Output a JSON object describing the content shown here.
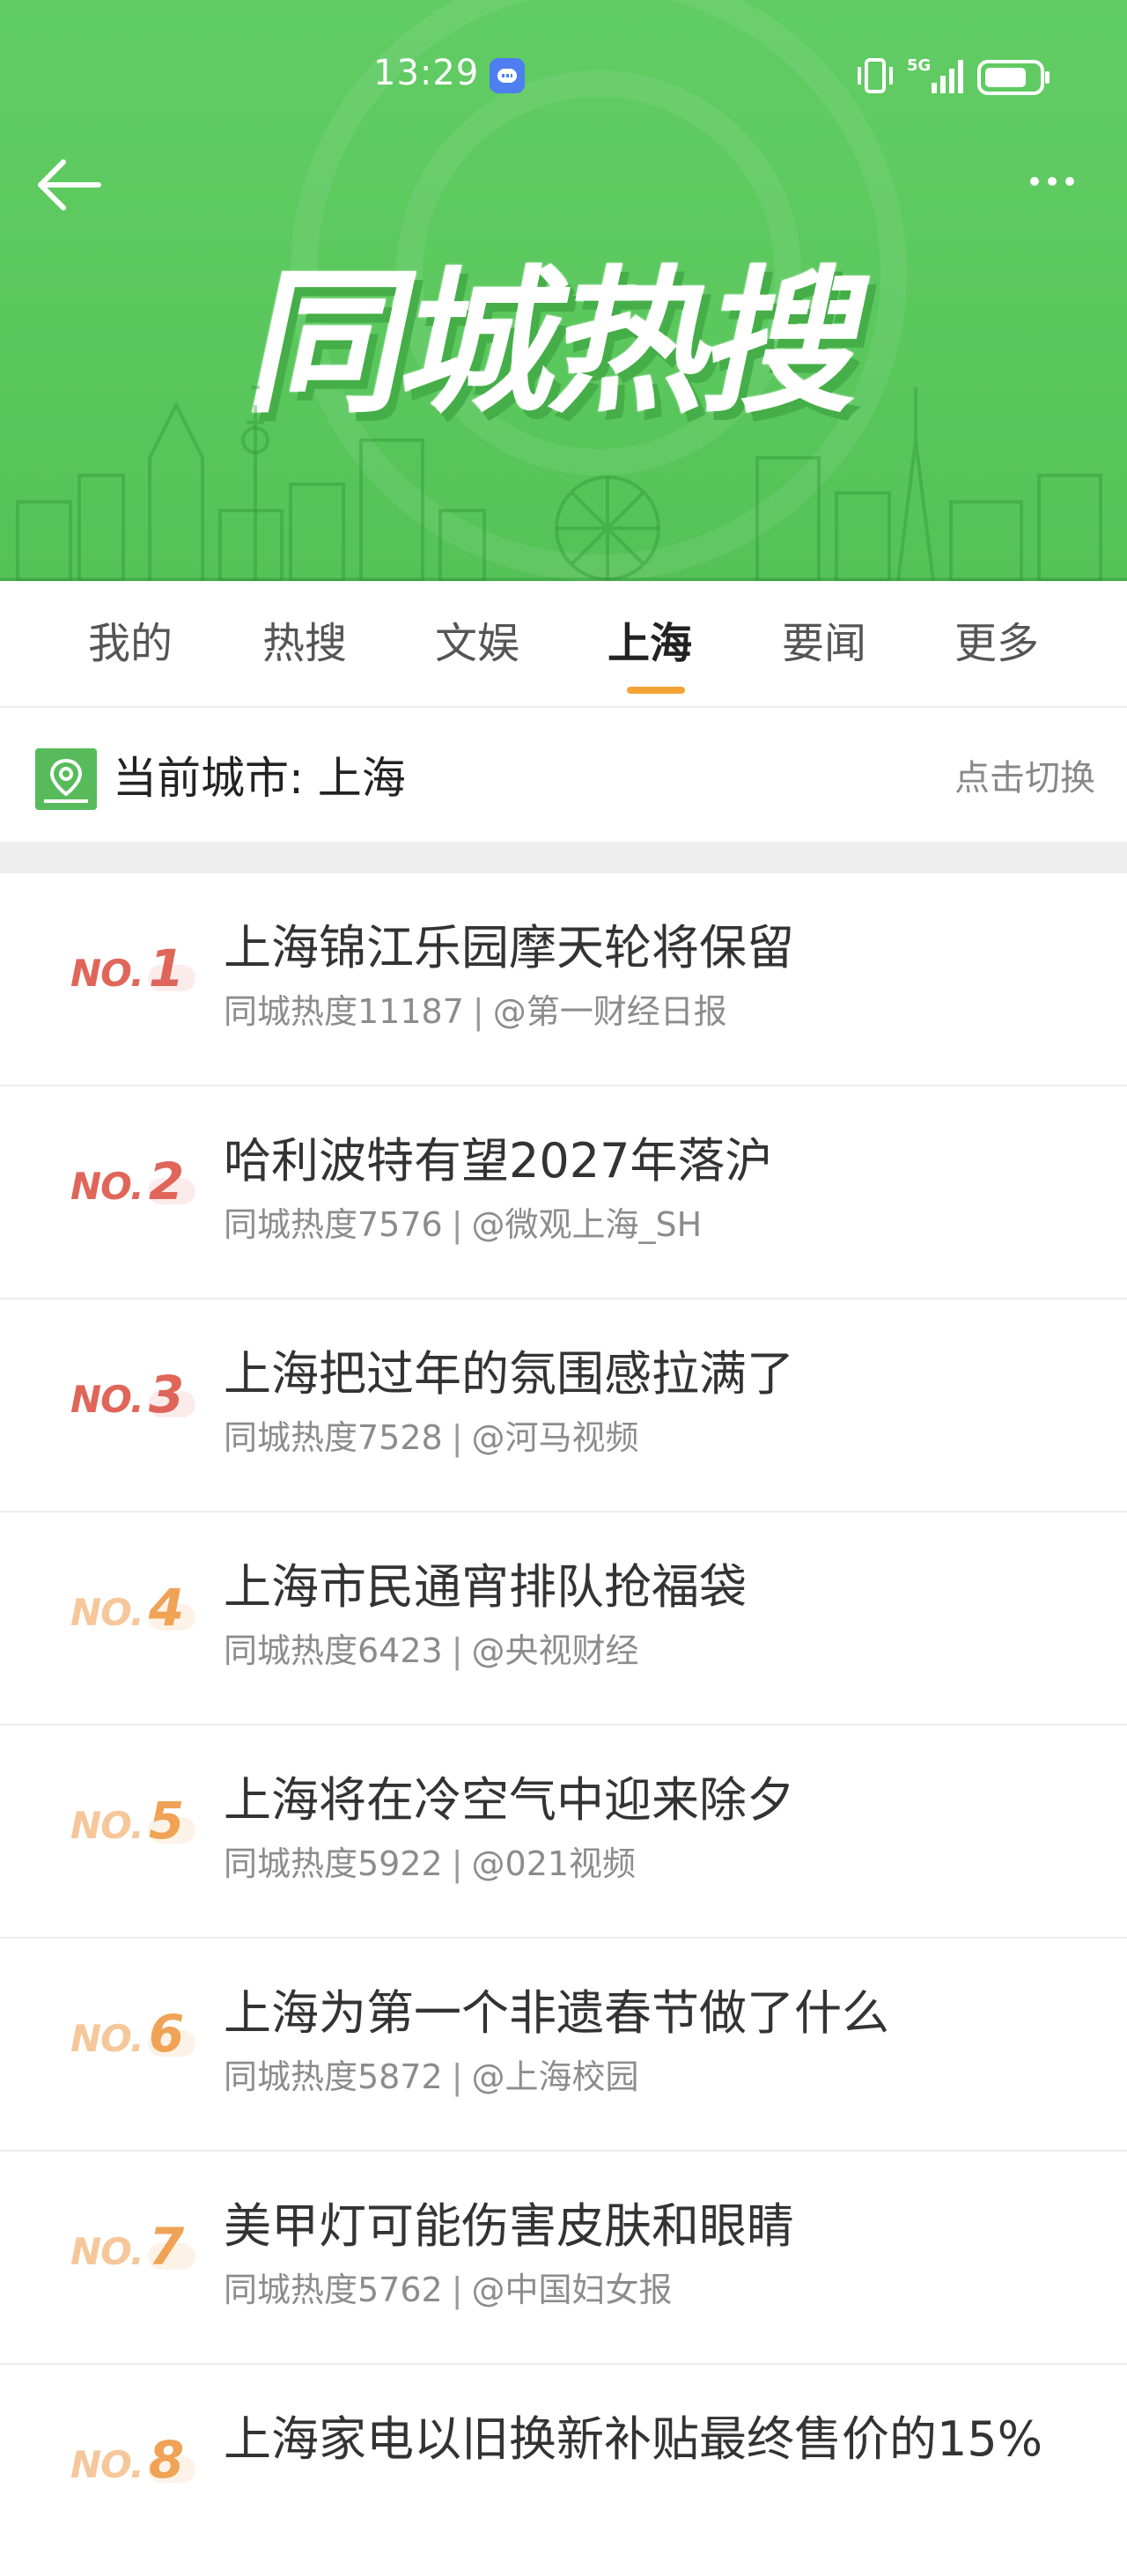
{
  "status_bar": {
    "time": "13:29",
    "network": "5G",
    "network_sub": "5G",
    "icons": [
      "message-icon",
      "vibrate-icon",
      "signal-icon",
      "battery-icon"
    ]
  },
  "header": {
    "title": "同城热搜",
    "back_icon": "back-arrow-icon",
    "more_icon": "more-icon",
    "colors": {
      "background": "#5bc85e",
      "title": "#ffffff"
    }
  },
  "tabs": [
    {
      "label": "我的",
      "active": false
    },
    {
      "label": "热搜",
      "active": false
    },
    {
      "label": "文娱",
      "active": false
    },
    {
      "label": "上海",
      "active": true
    },
    {
      "label": "要闻",
      "active": false
    },
    {
      "label": "更多",
      "active": false
    }
  ],
  "tab_indicator_color": "#f3a434",
  "city": {
    "label": "当前城市: 上海",
    "switch_label": "点击切换",
    "icon": "location-pin-icon"
  },
  "list": [
    {
      "no": "NO.",
      "rank": "1",
      "title": "上海锦江乐园摩天轮将保留",
      "heat": "同城热度11187",
      "sep": "|",
      "source": "@第一财经日报",
      "color": "#e0665a"
    },
    {
      "no": "NO.",
      "rank": "2",
      "title": "哈利波特有望2027年落沪",
      "heat": "同城热度7576",
      "sep": "|",
      "source": "@微观上海_SH",
      "color": "#e0665a"
    },
    {
      "no": "NO.",
      "rank": "3",
      "title": "上海把过年的氛围感拉满了",
      "heat": "同城热度7528",
      "sep": "|",
      "source": "@河马视频",
      "color": "#e0665a"
    },
    {
      "no": "NO.",
      "rank": "4",
      "title": "上海市民通宵排队抢福袋",
      "heat": "同城热度6423",
      "sep": "|",
      "source": "@央视财经",
      "color": "#f0a256"
    },
    {
      "no": "NO.",
      "rank": "5",
      "title": "上海将在冷空气中迎来除夕",
      "heat": "同城热度5922",
      "sep": "|",
      "source": "@021视频",
      "color": "#f0a256"
    },
    {
      "no": "NO.",
      "rank": "6",
      "title": "上海为第一个非遗春节做了什么",
      "heat": "同城热度5872",
      "sep": "|",
      "source": "@上海校园",
      "color": "#f0a256"
    },
    {
      "no": "NO.",
      "rank": "7",
      "title": "美甲灯可能伤害皮肤和眼睛",
      "heat": "同城热度5762",
      "sep": "|",
      "source": "@中国妇女报",
      "color": "#f0a256"
    },
    {
      "no": "NO.",
      "rank": "8",
      "title": "上海家电以旧换新补贴最终售价的15%",
      "heat": "",
      "sep": "",
      "source": "",
      "color": "#f0a256"
    }
  ]
}
